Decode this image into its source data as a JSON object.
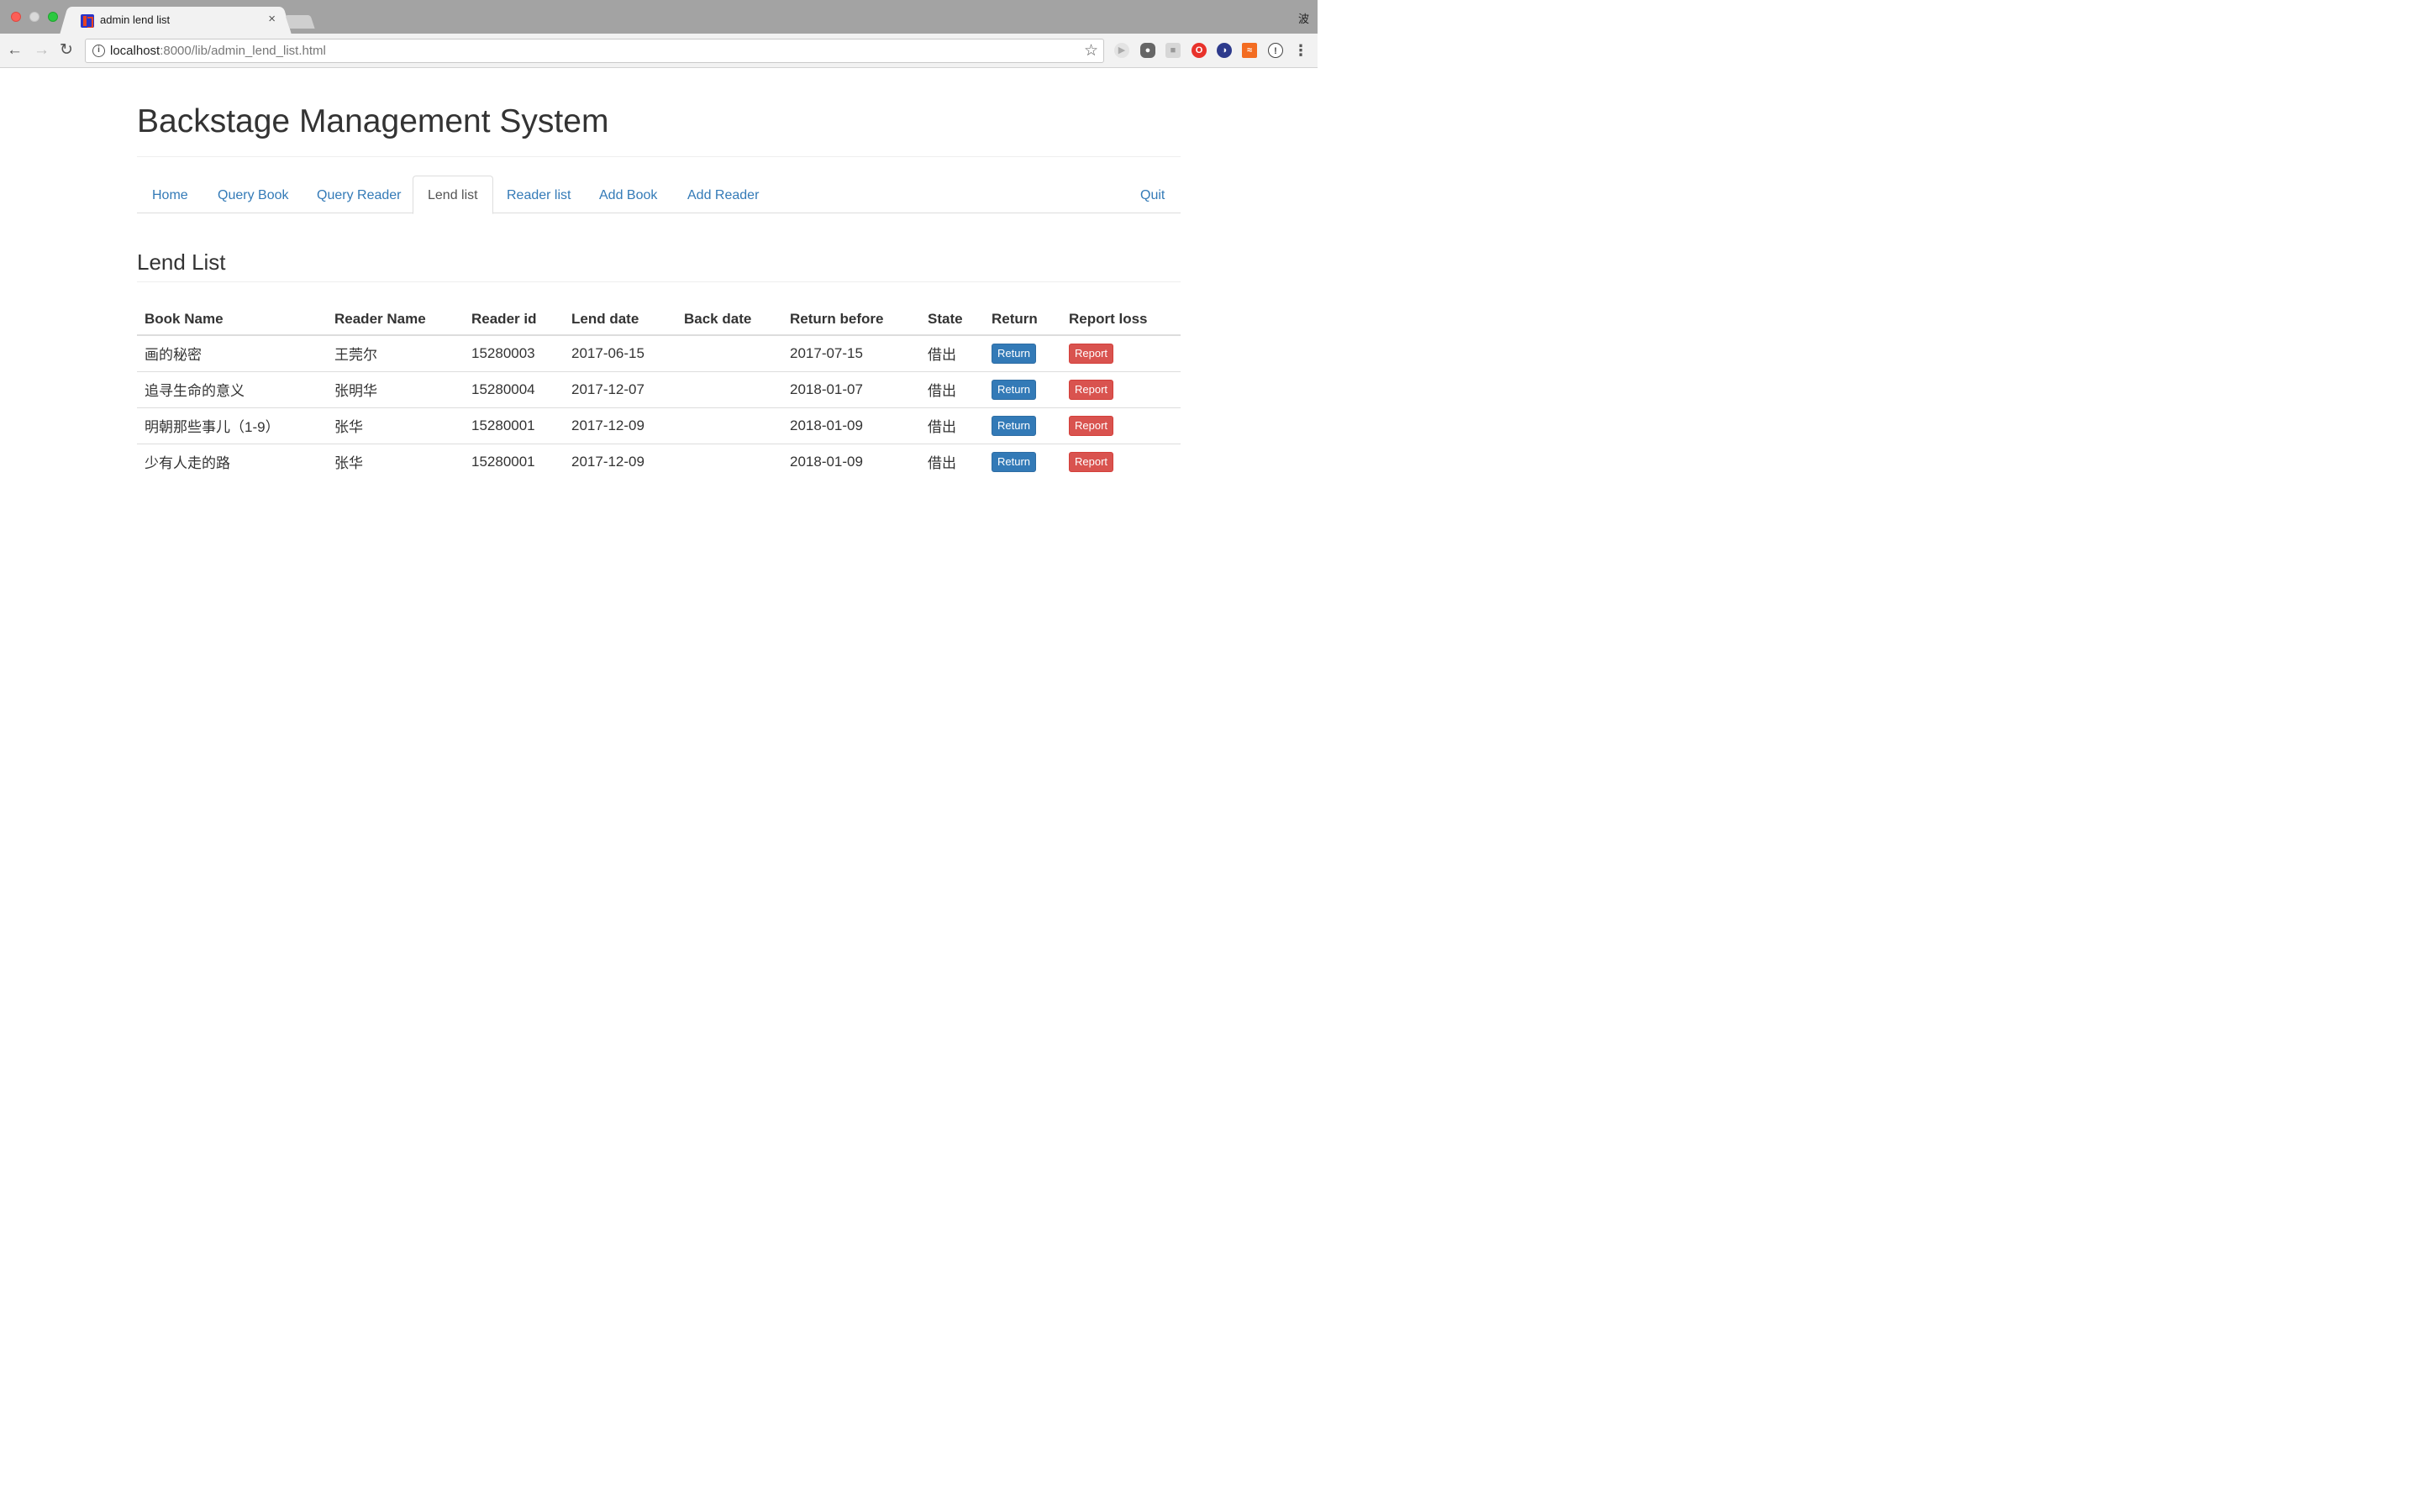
{
  "browser": {
    "tab_title": "admin lend list",
    "tab_close": "×",
    "url_host": "localhost",
    "url_rest": ":8000/lib/admin_lend_list.html",
    "ime_indicator": "波"
  },
  "header": {
    "title": "Backstage Management System"
  },
  "nav": {
    "home": "Home",
    "query_book": "Query Book",
    "query_reader": "Query Reader",
    "lend_list": "Lend list",
    "reader_list": "Reader list",
    "add_book": "Add Book",
    "add_reader": "Add Reader",
    "quit": "Quit"
  },
  "section": {
    "title": "Lend List"
  },
  "table": {
    "headers": {
      "book_name": "Book Name",
      "reader_name": "Reader Name",
      "reader_id": "Reader id",
      "lend_date": "Lend date",
      "back_date": "Back date",
      "return_before": "Return before",
      "state": "State",
      "return": "Return",
      "report_loss": "Report loss"
    },
    "rows": [
      {
        "book_name": "画的秘密",
        "reader_name": "王莞尔",
        "reader_id": "15280003",
        "lend_date": "2017-06-15",
        "back_date": "",
        "return_before": "2017-07-15",
        "state": "借出",
        "return_btn": "Return",
        "report_btn": "Report"
      },
      {
        "book_name": "追寻生命的意义",
        "reader_name": "张明华",
        "reader_id": "15280004",
        "lend_date": "2017-12-07",
        "back_date": "",
        "return_before": "2018-01-07",
        "state": "借出",
        "return_btn": "Return",
        "report_btn": "Report"
      },
      {
        "book_name": "明朝那些事儿（1-9）",
        "reader_name": "张华",
        "reader_id": "15280001",
        "lend_date": "2017-12-09",
        "back_date": "",
        "return_before": "2018-01-09",
        "state": "借出",
        "return_btn": "Return",
        "report_btn": "Report"
      },
      {
        "book_name": "少有人走的路",
        "reader_name": "张华",
        "reader_id": "15280001",
        "lend_date": "2017-12-09",
        "back_date": "",
        "return_before": "2018-01-09",
        "state": "借出",
        "return_btn": "Return",
        "report_btn": "Report"
      }
    ]
  },
  "colors": {
    "link": "#337ab7",
    "primary_button": "#337ab7",
    "danger_button": "#d9534f"
  }
}
